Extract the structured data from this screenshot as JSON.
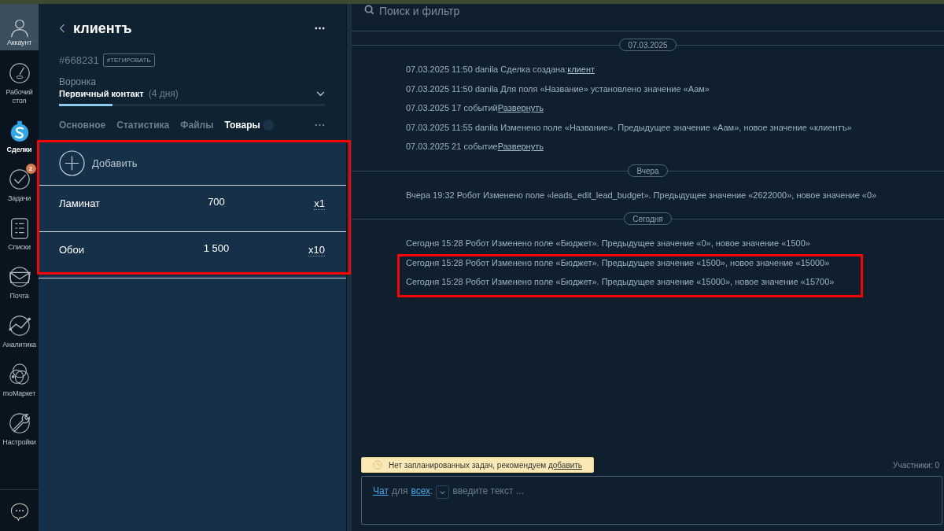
{
  "nav": {
    "account": "Аккаунт",
    "items": [
      {
        "label": "Рабочий стол",
        "selected": false
      },
      {
        "label": "Сделки",
        "selected": true
      },
      {
        "label": "Задачи",
        "selected": false,
        "badge": "2"
      },
      {
        "label": "Списки",
        "selected": false
      },
      {
        "label": "Почта",
        "selected": false
      },
      {
        "label": "Аналитика",
        "selected": false
      },
      {
        "label": "moМаркет",
        "selected": false
      },
      {
        "label": "Настройки",
        "selected": false
      }
    ]
  },
  "lead": {
    "title": "клиентъ",
    "id": "#668231",
    "tag_button": "#ТЕГИРОВАТЬ",
    "pipeline_label": "Воронка",
    "stage": "Первичный контакт",
    "stage_age": "(4 дня)",
    "stage_progress": {
      "level": 0.2
    },
    "tabs": [
      {
        "label": "Основное",
        "selected": false
      },
      {
        "label": "Статистика",
        "selected": false
      },
      {
        "label": "Файлы",
        "selected": false
      },
      {
        "label": "Товары",
        "selected": true
      }
    ],
    "add_button": "Добавить",
    "products": [
      {
        "name": "Ламинат",
        "price": "700",
        "quantity": "x1"
      },
      {
        "name": "Обои",
        "price": "1 500",
        "quantity": "x10"
      }
    ]
  },
  "feed": {
    "search": {
      "placeholder": "Поиск и фильтр"
    },
    "groups": [
      {
        "date": "07.03.2025",
        "events": [
          {
            "text": "07.03.2025 11:50 danila Сделка создана:",
            "link": "клиент"
          },
          {
            "text": "07.03.2025 11:50 danila Для поля «Название» установлено значение «Аам»"
          },
          {
            "text": "07.03.2025 17 событий",
            "link": "Развернуть"
          },
          {
            "text": "07.03.2025 11:55 danila Изменено поле «Название». Предыдущее значение «Аам», новое значение «клиентъ»"
          },
          {
            "text": "07.03.2025 21 событие",
            "link": "Развернуть"
          }
        ]
      },
      {
        "date": "Вчера",
        "events": [
          {
            "text": "Вчера 19:32 Робот Изменено поле «leads_edit_lead_budget». Предыдущее значение «2622000», новое значение «0»"
          }
        ]
      },
      {
        "date": "Сегодня",
        "events": [
          {
            "text": "Сегодня 15:28 Робот Изменено поле «Бюджет». Предыдущее значение «0», новое значение «1500»"
          },
          {
            "text": "Сегодня 15:28 Робот Изменено поле «Бюджет». Предыдущее значение «1500», новое значение «15000»"
          },
          {
            "text": "Сегодня 15:28 Робот Изменено поле «Бюджет». Предыдущее значение «15000», новое значение «15700»"
          }
        ]
      }
    ],
    "task_notice": {
      "text": "Нет запланированных задач, рекомендуем",
      "link": "добавить"
    },
    "participants": "Участники: 0",
    "chat": {
      "link_1": "Чат",
      "middle": "для",
      "link_2": "всех",
      "colon": ":",
      "placeholder": "введите текст ..."
    }
  }
}
